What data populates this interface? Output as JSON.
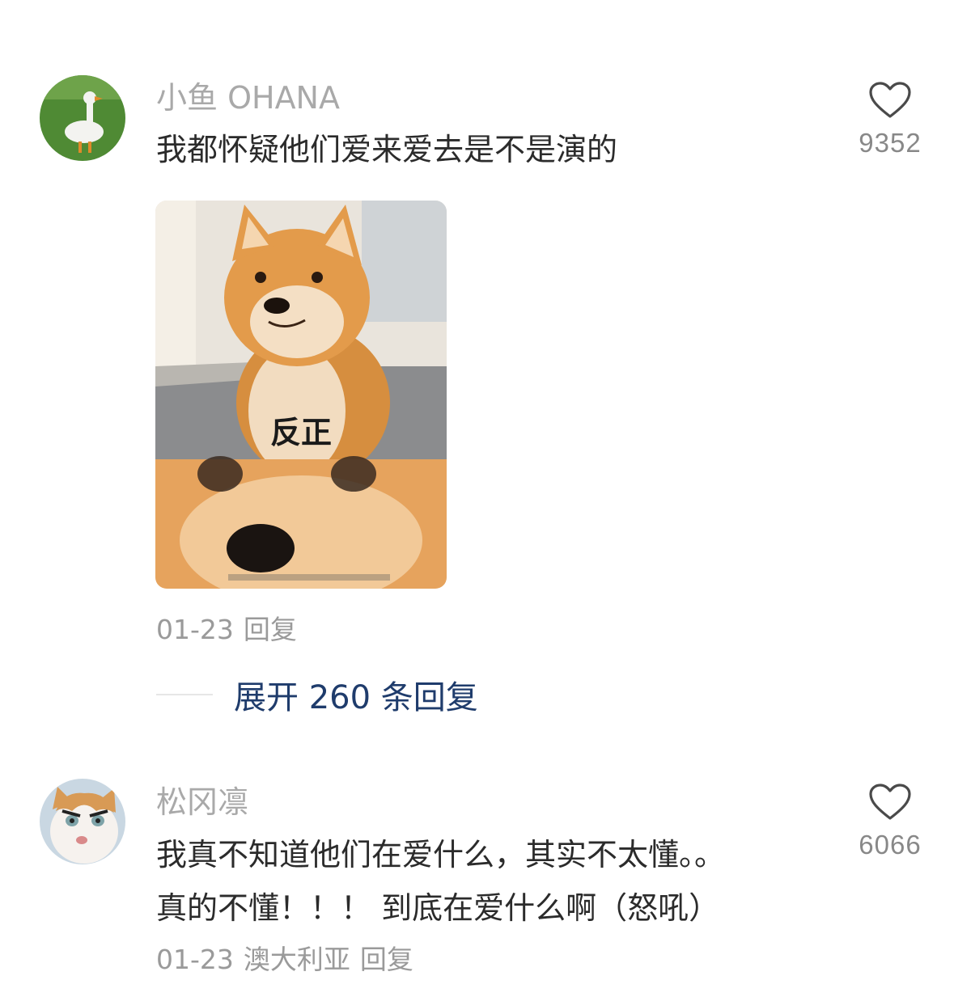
{
  "comments": [
    {
      "username": "小鱼 OHANA",
      "text": "我都怀疑他们爱来爱去是不是演的",
      "image_caption": "反正",
      "date": "01-23",
      "location": "",
      "reply_label": "回复",
      "like_count": "9352",
      "expand_replies": "展开 260 条回复",
      "avatar": "goose-avatar"
    },
    {
      "username": "松冈凛",
      "text": "我真不知道他们在爱什么，其实不太懂。。\n真的不懂！！！ 到底在爱什么啊（怒吼）",
      "date": "01-23",
      "location": "澳大利亚",
      "reply_label": "回复",
      "like_count": "6066",
      "avatar": "cat-avatar"
    }
  ],
  "icons": {
    "like": "heart-outline-icon"
  },
  "colors": {
    "username": "#a9a9a9",
    "body_text": "#2b2b2b",
    "link": "#1f3c6c"
  }
}
